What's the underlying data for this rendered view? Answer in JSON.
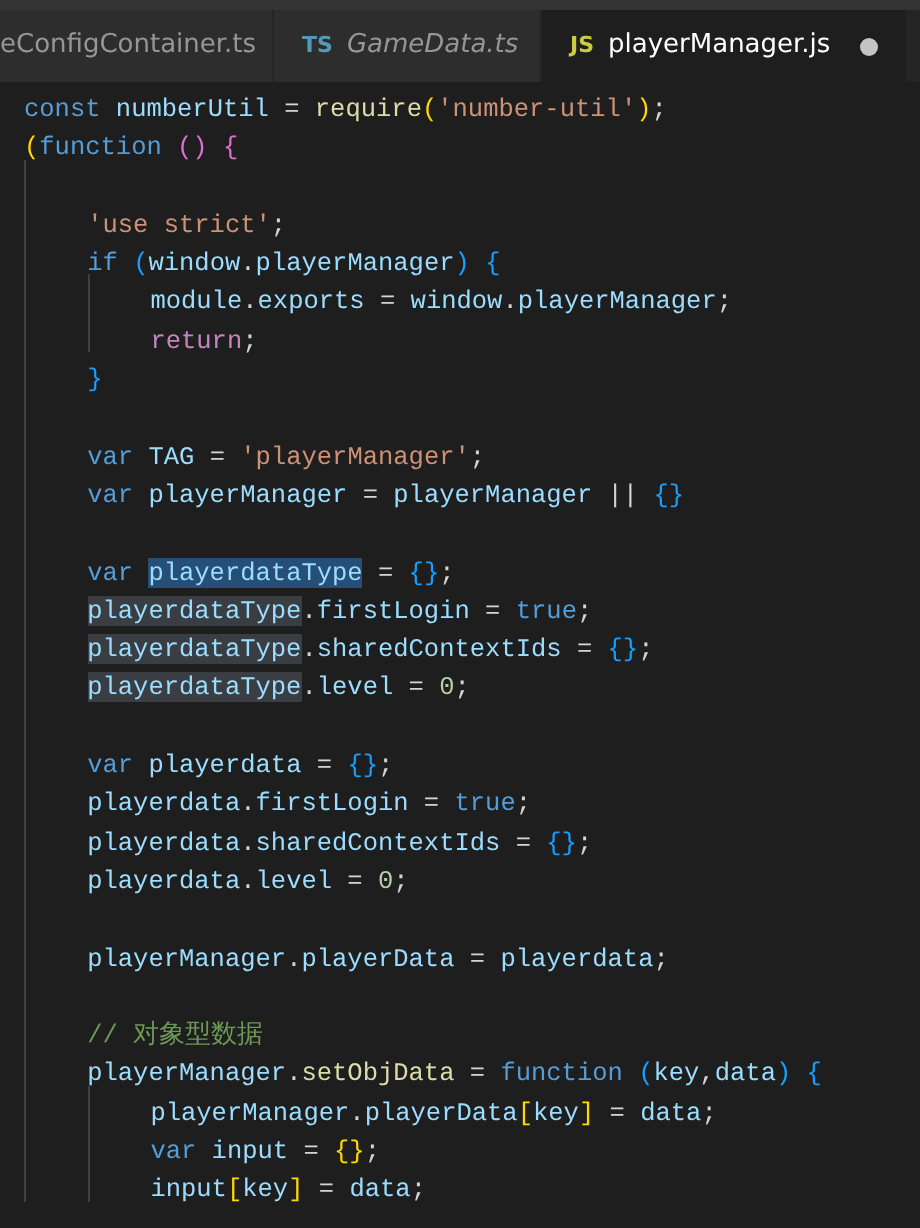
{
  "tabs": [
    {
      "label": "eConfigContainer.ts",
      "preview": false,
      "selected": false
    },
    {
      "badge": {
        "text": "TS",
        "color": "#519aba"
      },
      "label": "GameData.ts",
      "preview": true,
      "selected": false
    },
    {
      "badge": {
        "text": "JS",
        "color": "#cbcb41"
      },
      "label": "playerManager.js",
      "preview": false,
      "modified": true,
      "selected": true
    }
  ],
  "code_lines": [
    {
      "tokens": [
        {
          "kind": "keyword",
          "text": "const "
        },
        {
          "kind": "variable",
          "text": "numberUtil"
        },
        {
          "kind": "punct",
          "text": " = "
        },
        {
          "kind": "function",
          "text": "require"
        },
        {
          "kind": "bracket1",
          "text": "("
        },
        {
          "kind": "string",
          "text": "'number-util'"
        },
        {
          "kind": "bracket1",
          "text": ")"
        },
        {
          "kind": "punct",
          "text": ";"
        }
      ]
    },
    {
      "tokens": [
        {
          "kind": "bracket1",
          "text": "("
        },
        {
          "kind": "keyword",
          "text": "function "
        },
        {
          "kind": "bracket2",
          "text": "() {"
        }
      ],
      "children": [
        {
          "gap_before": true,
          "tokens": [
            {
              "kind": "string",
              "text": "'use strict'"
            },
            {
              "kind": "punct",
              "text": ";"
            }
          ]
        },
        {
          "tokens": [
            {
              "kind": "keyword",
              "text": "if "
            },
            {
              "kind": "bracket3",
              "text": "("
            },
            {
              "kind": "variable",
              "text": "window"
            },
            {
              "kind": "punct",
              "text": "."
            },
            {
              "kind": "variable",
              "text": "playerManager"
            },
            {
              "kind": "bracket3",
              "text": ") {"
            }
          ],
          "children": [
            {
              "tokens": [
                {
                  "kind": "variable",
                  "text": "module"
                },
                {
                  "kind": "punct",
                  "text": "."
                },
                {
                  "kind": "variable",
                  "text": "exports"
                },
                {
                  "kind": "punct",
                  "text": " = "
                },
                {
                  "kind": "variable",
                  "text": "window"
                },
                {
                  "kind": "punct",
                  "text": "."
                },
                {
                  "kind": "variable",
                  "text": "playerManager"
                },
                {
                  "kind": "punct",
                  "text": ";"
                }
              ]
            },
            {
              "tokens": [
                {
                  "kind": "control",
                  "text": "return"
                },
                {
                  "kind": "punct",
                  "text": ";"
                }
              ]
            }
          ]
        },
        {
          "tokens": [
            {
              "kind": "bracket3",
              "text": "}"
            }
          ]
        },
        {
          "gap_before": true,
          "tokens": [
            {
              "kind": "keyword",
              "text": "var "
            },
            {
              "kind": "variable",
              "text": "TAG"
            },
            {
              "kind": "punct",
              "text": " = "
            },
            {
              "kind": "string",
              "text": "'playerManager'"
            },
            {
              "kind": "punct",
              "text": ";"
            }
          ]
        },
        {
          "tokens": [
            {
              "kind": "keyword",
              "text": "var "
            },
            {
              "kind": "variable",
              "text": "playerManager"
            },
            {
              "kind": "punct",
              "text": " = "
            },
            {
              "kind": "variable",
              "text": "playerManager"
            },
            {
              "kind": "punct",
              "text": " || "
            },
            {
              "kind": "bracket3",
              "text": "{}"
            }
          ]
        },
        {
          "gap_before": true,
          "tokens": [
            {
              "kind": "keyword",
              "text": "var "
            },
            {
              "kind": "variable",
              "text": "playerdataType",
              "selection": true
            },
            {
              "kind": "punct",
              "text": " = "
            },
            {
              "kind": "bracket3",
              "text": "{}"
            },
            {
              "kind": "punct",
              "text": ";"
            }
          ]
        },
        {
          "tokens": [
            {
              "kind": "variable",
              "text": "playerdataType",
              "match": true
            },
            {
              "kind": "punct",
              "text": "."
            },
            {
              "kind": "variable",
              "text": "firstLogin"
            },
            {
              "kind": "punct",
              "text": " = "
            },
            {
              "kind": "keyword",
              "text": "true"
            },
            {
              "kind": "punct",
              "text": ";"
            }
          ]
        },
        {
          "tokens": [
            {
              "kind": "variable",
              "text": "playerdataType",
              "match": true
            },
            {
              "kind": "punct",
              "text": "."
            },
            {
              "kind": "variable",
              "text": "sharedContextIds"
            },
            {
              "kind": "punct",
              "text": " = "
            },
            {
              "kind": "bracket3",
              "text": "{}"
            },
            {
              "kind": "punct",
              "text": ";"
            }
          ]
        },
        {
          "tokens": [
            {
              "kind": "variable",
              "text": "playerdataType",
              "match": true
            },
            {
              "kind": "punct",
              "text": "."
            },
            {
              "kind": "variable",
              "text": "level"
            },
            {
              "kind": "punct",
              "text": " = "
            },
            {
              "kind": "number",
              "text": "0"
            },
            {
              "kind": "punct",
              "text": ";"
            }
          ]
        },
        {
          "gap_before": true,
          "tokens": [
            {
              "kind": "keyword",
              "text": "var "
            },
            {
              "kind": "variable",
              "text": "playerdata"
            },
            {
              "kind": "punct",
              "text": " = "
            },
            {
              "kind": "bracket3",
              "text": "{}"
            },
            {
              "kind": "punct",
              "text": ";"
            }
          ]
        },
        {
          "tokens": [
            {
              "kind": "variable",
              "text": "playerdata"
            },
            {
              "kind": "punct",
              "text": "."
            },
            {
              "kind": "variable",
              "text": "firstLogin"
            },
            {
              "kind": "punct",
              "text": " = "
            },
            {
              "kind": "keyword",
              "text": "true"
            },
            {
              "kind": "punct",
              "text": ";"
            }
          ]
        },
        {
          "tokens": [
            {
              "kind": "variable",
              "text": "playerdata"
            },
            {
              "kind": "punct",
              "text": "."
            },
            {
              "kind": "variable",
              "text": "sharedContextIds"
            },
            {
              "kind": "punct",
              "text": " = "
            },
            {
              "kind": "bracket3",
              "text": "{}"
            },
            {
              "kind": "punct",
              "text": ";"
            }
          ]
        },
        {
          "tokens": [
            {
              "kind": "variable",
              "text": "playerdata"
            },
            {
              "kind": "punct",
              "text": "."
            },
            {
              "kind": "variable",
              "text": "level"
            },
            {
              "kind": "punct",
              "text": " = "
            },
            {
              "kind": "number",
              "text": "0"
            },
            {
              "kind": "punct",
              "text": ";"
            }
          ]
        },
        {
          "gap_before": true,
          "tokens": [
            {
              "kind": "variable",
              "text": "playerManager"
            },
            {
              "kind": "punct",
              "text": "."
            },
            {
              "kind": "variable",
              "text": "playerData"
            },
            {
              "kind": "punct",
              "text": " = "
            },
            {
              "kind": "variable",
              "text": "playerdata"
            },
            {
              "kind": "punct",
              "text": ";"
            }
          ]
        },
        {
          "gap_before": true,
          "tokens": [
            {
              "kind": "comment",
              "text": "// 对象型数据"
            }
          ]
        },
        {
          "tokens": [
            {
              "kind": "variable",
              "text": "playerManager"
            },
            {
              "kind": "punct",
              "text": "."
            },
            {
              "kind": "function",
              "text": "setObjData"
            },
            {
              "kind": "punct",
              "text": " = "
            },
            {
              "kind": "keyword",
              "text": "function "
            },
            {
              "kind": "bracket3",
              "text": "("
            },
            {
              "kind": "variable",
              "text": "key"
            },
            {
              "kind": "punct",
              "text": ","
            },
            {
              "kind": "variable",
              "text": "data"
            },
            {
              "kind": "bracket3",
              "text": ") {"
            }
          ],
          "children": [
            {
              "tokens": [
                {
                  "kind": "variable",
                  "text": "playerManager"
                },
                {
                  "kind": "punct",
                  "text": "."
                },
                {
                  "kind": "variable",
                  "text": "playerData"
                },
                {
                  "kind": "bracket1",
                  "text": "["
                },
                {
                  "kind": "variable",
                  "text": "key"
                },
                {
                  "kind": "bracket1",
                  "text": "]"
                },
                {
                  "kind": "punct",
                  "text": " = "
                },
                {
                  "kind": "variable",
                  "text": "data"
                },
                {
                  "kind": "punct",
                  "text": ";"
                }
              ]
            },
            {
              "tokens": [
                {
                  "kind": "keyword",
                  "text": "var "
                },
                {
                  "kind": "variable",
                  "text": "input"
                },
                {
                  "kind": "punct",
                  "text": " = "
                },
                {
                  "kind": "bracket1",
                  "text": "{}"
                },
                {
                  "kind": "punct",
                  "text": ";"
                }
              ]
            },
            {
              "tokens": [
                {
                  "kind": "variable",
                  "text": "input"
                },
                {
                  "kind": "bracket1",
                  "text": "["
                },
                {
                  "kind": "variable",
                  "text": "key"
                },
                {
                  "kind": "bracket1",
                  "text": "]"
                },
                {
                  "kind": "punct",
                  "text": " = "
                },
                {
                  "kind": "variable",
                  "text": "data"
                },
                {
                  "kind": "punct",
                  "text": ";"
                }
              ]
            }
          ]
        }
      ]
    }
  ]
}
